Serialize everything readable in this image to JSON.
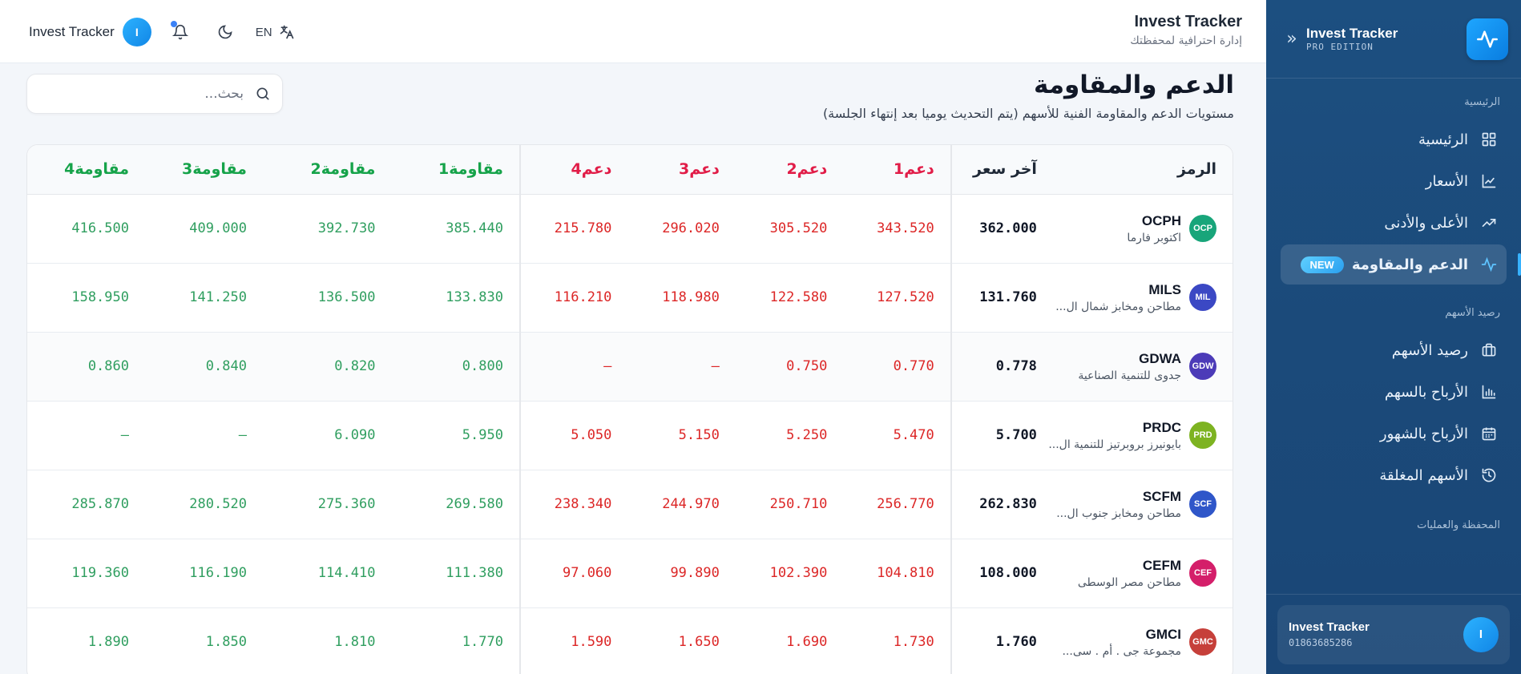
{
  "sidebar": {
    "brand_title": "Invest Tracker",
    "brand_sub": "PRO EDITION",
    "collapse_icon": "«",
    "sections": {
      "main": "الرئيسية",
      "stocks": "رصيد الأسهم",
      "portfolio": "المحفظة والعمليات"
    },
    "items": [
      {
        "label": "الرئيسية",
        "icon": "grid-icon"
      },
      {
        "label": "الأسعار",
        "icon": "line-chart-icon"
      },
      {
        "label": "الأعلى والأدنى",
        "icon": "trending-up-icon"
      },
      {
        "label": "الدعم والمقاومة",
        "icon": "pulse-icon",
        "badge": "NEW",
        "active": true
      },
      {
        "label": "رصيد الأسهم",
        "icon": "briefcase-icon"
      },
      {
        "label": "الأرباح بالسهم",
        "icon": "bar-chart-icon"
      },
      {
        "label": "الأرباح بالشهور",
        "icon": "calendar-icon"
      },
      {
        "label": "الأسهم المغلقة",
        "icon": "history-icon"
      }
    ],
    "user": {
      "initial": "I",
      "name": "Invest Tracker",
      "id": "01863685286"
    }
  },
  "topbar": {
    "title": "Invest Tracker",
    "subtitle": "إدارة احترافية لمحفظتك",
    "user_name": "Invest Tracker",
    "user_initial": "I",
    "lang": "EN"
  },
  "page": {
    "title": "الدعم والمقاومة",
    "subtitle": "مستويات الدعم والمقاومة الفنية للأسهم (يتم التحديث يوميا بعد إنتهاء الجلسة)",
    "search_placeholder": "بحث..."
  },
  "table": {
    "headers": {
      "symbol": "الرمز",
      "last": "آخر سعر",
      "s1": "دعم1",
      "s2": "دعم2",
      "s3": "دعم3",
      "s4": "دعم4",
      "r1": "مقاومة1",
      "r2": "مقاومة2",
      "r3": "مقاومة3",
      "r4": "مقاومة4"
    },
    "rows": [
      {
        "code": "OCPH",
        "chip": "OCP",
        "chip_color": "#18a57a",
        "name": "اكتوبر فارما",
        "last": "362.000",
        "s1": "343.520",
        "s2": "305.520",
        "s3": "296.020",
        "s4": "215.780",
        "r1": "385.440",
        "r2": "392.730",
        "r3": "409.000",
        "r4": "416.500"
      },
      {
        "code": "MILS",
        "chip": "MIL",
        "chip_color": "#3b48c4",
        "name": "مطاحن ومخابز شمال ال...",
        "last": "131.760",
        "s1": "127.520",
        "s2": "122.580",
        "s3": "118.980",
        "s4": "116.210",
        "r1": "133.830",
        "r2": "136.500",
        "r3": "141.250",
        "r4": "158.950"
      },
      {
        "code": "GDWA",
        "chip": "GDW",
        "chip_color": "#4c3bb8",
        "name": "جدوى للتنمية الصناعية",
        "last": "0.778",
        "s1": "0.770",
        "s2": "0.750",
        "s3": "—",
        "s4": "—",
        "r1": "0.800",
        "r2": "0.820",
        "r3": "0.840",
        "r4": "0.860"
      },
      {
        "code": "PRDC",
        "chip": "PRD",
        "chip_color": "#7db321",
        "name": "بايونيرز بروبرتيز للتنمية ال...",
        "last": "5.700",
        "s1": "5.470",
        "s2": "5.250",
        "s3": "5.150",
        "s4": "5.050",
        "r1": "5.950",
        "r2": "6.090",
        "r3": "—",
        "r4": "—"
      },
      {
        "code": "SCFM",
        "chip": "SCF",
        "chip_color": "#2f56c9",
        "name": "مطاحن ومخابز جنوب ال...",
        "last": "262.830",
        "s1": "256.770",
        "s2": "250.710",
        "s3": "244.970",
        "s4": "238.340",
        "r1": "269.580",
        "r2": "275.360",
        "r3": "280.520",
        "r4": "285.870"
      },
      {
        "code": "CEFM",
        "chip": "CEF",
        "chip_color": "#d41f6a",
        "name": "مطاحن مصر الوسطى",
        "last": "108.000",
        "s1": "104.810",
        "s2": "102.390",
        "s3": "99.890",
        "s4": "97.060",
        "r1": "111.380",
        "r2": "114.410",
        "r3": "116.190",
        "r4": "119.360"
      },
      {
        "code": "GMCI",
        "chip": "GMC",
        "chip_color": "#c6403a",
        "name": "مجموعة جى . أم . سى...",
        "last": "1.760",
        "s1": "1.730",
        "s2": "1.690",
        "s3": "1.650",
        "s4": "1.590",
        "r1": "1.770",
        "r2": "1.810",
        "r3": "1.850",
        "r4": "1.890"
      }
    ]
  }
}
